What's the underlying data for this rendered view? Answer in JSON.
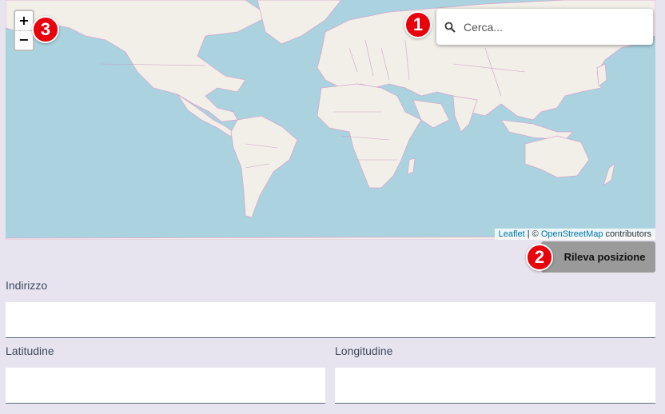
{
  "map": {
    "zoom_in_label": "+",
    "zoom_out_label": "−",
    "search": {
      "placeholder": "Cerca...",
      "value": ""
    },
    "attribution": {
      "leaflet": "Leaflet",
      "separator": " | © ",
      "osm": "OpenStreetMap",
      "suffix": " contributors"
    }
  },
  "badges": {
    "b1": "1",
    "b2": "2",
    "b3": "3"
  },
  "locate_button": {
    "label": "Rileva posizione"
  },
  "form": {
    "address": {
      "label": "Indirizzo",
      "value": ""
    },
    "latitude": {
      "label": "Latitudine",
      "value": ""
    },
    "longitude": {
      "label": "Longitudine",
      "value": ""
    }
  },
  "colors": {
    "water": "#aad3df",
    "land": "#f2efe9",
    "border": "#c78fc0",
    "badge": "#e8000b"
  }
}
